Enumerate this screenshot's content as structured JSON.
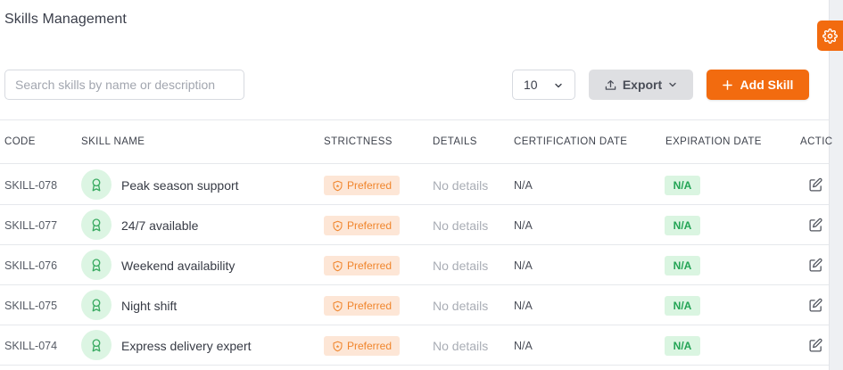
{
  "header": {
    "title": "Skills Management"
  },
  "toolbar": {
    "search_placeholder": "Search skills by name or description",
    "page_size": "10",
    "export_label": "Export",
    "add_label": "Add Skill"
  },
  "table": {
    "columns": [
      "CODE",
      "SKILL NAME",
      "STRICTNESS",
      "DETAILS",
      "CERTIFICATION DATE",
      "EXPIRATION DATE",
      "ACTIC"
    ],
    "rows": [
      {
        "code": "SKILL-078",
        "name": "Peak season support",
        "strictness": "Preferred",
        "details": "No details",
        "cert_date": "N/A",
        "exp_date": "N/A"
      },
      {
        "code": "SKILL-077",
        "name": "24/7 available",
        "strictness": "Preferred",
        "details": "No details",
        "cert_date": "N/A",
        "exp_date": "N/A"
      },
      {
        "code": "SKILL-076",
        "name": "Weekend availability",
        "strictness": "Preferred",
        "details": "No details",
        "cert_date": "N/A",
        "exp_date": "N/A"
      },
      {
        "code": "SKILL-075",
        "name": "Night shift",
        "strictness": "Preferred",
        "details": "No details",
        "cert_date": "N/A",
        "exp_date": "N/A"
      },
      {
        "code": "SKILL-074",
        "name": "Express delivery expert",
        "strictness": "Preferred",
        "details": "No details",
        "cert_date": "N/A",
        "exp_date": "N/A"
      }
    ]
  },
  "icons": {
    "settings": "gear-icon",
    "export": "upload-icon",
    "add": "plus-icon",
    "dropdown": "chevron-down-icon",
    "skill": "award-icon",
    "strictness": "shield-star-icon",
    "edit": "pencil-icon"
  },
  "colors": {
    "accent": "#f26b0f",
    "preferred_bg": "#fde6d6",
    "preferred_text": "#f0852c",
    "na_bg": "#daf5e1",
    "na_text": "#23a455",
    "avatar_bg": "#dcf5e3"
  }
}
